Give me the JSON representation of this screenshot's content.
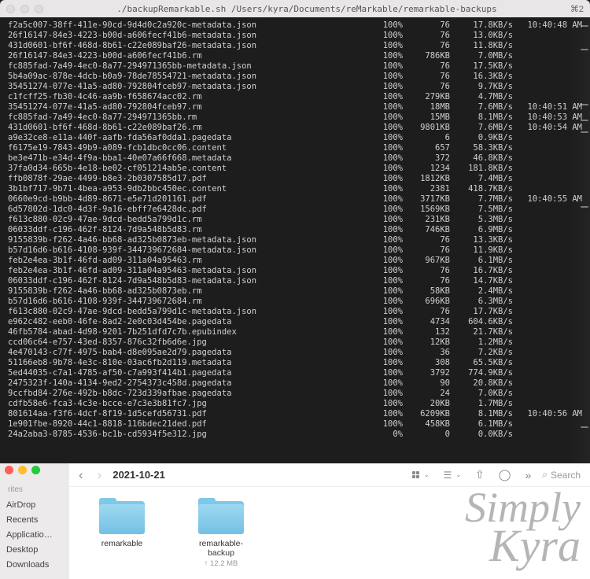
{
  "terminal": {
    "title": "./backupRemarkable.sh /Users/kyra/Documents/reMarkable/remarkable-backups",
    "shortcut": "⌘2",
    "rows": [
      {
        "f": "f2a5c007-38ff-411e-90cd-9d4d0c2a920c-metadata.json",
        "p": "100%",
        "s": "76",
        "r": "17.8KB/s",
        "t": "10:40:48 AM"
      },
      {
        "f": "26f16147-84e3-4223-b00d-a606fecf41b6-metadata.json",
        "p": "100%",
        "s": "76",
        "r": "13.0KB/s",
        "t": ""
      },
      {
        "f": "431d0601-bf6f-468d-8b61-c22e089baf26-metadata.json",
        "p": "100%",
        "s": "76",
        "r": "11.8KB/s",
        "t": ""
      },
      {
        "f": "26f16147-84e3-4223-b00d-a606fecf41b6.rm",
        "p": "100%",
        "s": "786KB",
        "r": "7.0MB/s",
        "t": ""
      },
      {
        "f": "fc885fad-7a49-4ec0-8a77-294971365bb-metadata.json",
        "p": "100%",
        "s": "76",
        "r": "17.5KB/s",
        "t": ""
      },
      {
        "f": "5b4a09ac-878e-4dcb-b0a9-78de78554721-metadata.json",
        "p": "100%",
        "s": "76",
        "r": "16.3KB/s",
        "t": ""
      },
      {
        "f": "35451274-077e-41a5-ad80-792804fceb97-metadata.json",
        "p": "100%",
        "s": "76",
        "r": "9.7KB/s",
        "t": ""
      },
      {
        "f": "c1fcff25-fb30-4c46-aa9b-f658674acc02.rm",
        "p": "100%",
        "s": "279KB",
        "r": "4.7MB/s",
        "t": ""
      },
      {
        "f": "35451274-077e-41a5-ad80-792804fceb97.rm",
        "p": "100%",
        "s": "18MB",
        "r": "7.6MB/s",
        "t": "10:40:51 AM"
      },
      {
        "f": "fc885fad-7a49-4ec0-8a77-294971365bb.rm",
        "p": "100%",
        "s": "15MB",
        "r": "8.1MB/s",
        "t": "10:40:53 AM"
      },
      {
        "f": "431d0601-bf6f-468d-8b61-c22e089baf26.rm",
        "p": "100%",
        "s": "9801KB",
        "r": "7.6MB/s",
        "t": "10:40:54 AM"
      },
      {
        "f": "a9e32ce8-e11a-440f-aafb-fda56af0dda1.pagedata",
        "p": "100%",
        "s": "6",
        "r": "0.9KB/s",
        "t": ""
      },
      {
        "f": "f6175e19-7843-49b9-a089-fcb1dbc0cc06.content",
        "p": "100%",
        "s": "657",
        "r": "58.3KB/s",
        "t": ""
      },
      {
        "f": "be3e471b-e34d-4f9a-bba1-40e07a66f668.metadata",
        "p": "100%",
        "s": "372",
        "r": "46.8KB/s",
        "t": ""
      },
      {
        "f": "37fa0d34-665b-4e18-be02-cf051214ab5e.content",
        "p": "100%",
        "s": "1234",
        "r": "181.8KB/s",
        "t": ""
      },
      {
        "f": "ffb0878f-29ae-4499-b8e3-2b0307585d17.pdf",
        "p": "100%",
        "s": "1812KB",
        "r": "7.4MB/s",
        "t": ""
      },
      {
        "f": "3b1bf717-9b71-4bea-a953-9db2bbc450ec.content",
        "p": "100%",
        "s": "2381",
        "r": "418.7KB/s",
        "t": ""
      },
      {
        "f": "0660e9cd-b9bb-4d89-8671-e5e71d201161.pdf",
        "p": "100%",
        "s": "3717KB",
        "r": "7.7MB/s",
        "t": "10:40:55 AM"
      },
      {
        "f": "6d57802d-1dc0-4d3f-9a16-ebff7e6428dc.pdf",
        "p": "100%",
        "s": "1569KB",
        "r": "7.5MB/s",
        "t": ""
      },
      {
        "f": "f613c880-02c9-47ae-9dcd-bedd5a799d1c.rm",
        "p": "100%",
        "s": "231KB",
        "r": "5.3MB/s",
        "t": ""
      },
      {
        "f": "06033ddf-c196-462f-8124-7d9a548b5d83.rm",
        "p": "100%",
        "s": "746KB",
        "r": "6.9MB/s",
        "t": ""
      },
      {
        "f": "9155839b-f262-4a46-bb68-ad325b0873eb-metadata.json",
        "p": "100%",
        "s": "76",
        "r": "13.3KB/s",
        "t": ""
      },
      {
        "f": "b57d16d6-b616-4108-939f-344739672684-metadata.json",
        "p": "100%",
        "s": "76",
        "r": "11.9KB/s",
        "t": ""
      },
      {
        "f": "feb2e4ea-3b1f-46fd-ad09-311a04a95463.rm",
        "p": "100%",
        "s": "967KB",
        "r": "6.1MB/s",
        "t": ""
      },
      {
        "f": "feb2e4ea-3b1f-46fd-ad09-311a04a95463-metadata.json",
        "p": "100%",
        "s": "76",
        "r": "16.7KB/s",
        "t": ""
      },
      {
        "f": "06033ddf-c196-462f-8124-7d9a548b5d83-metadata.json",
        "p": "100%",
        "s": "76",
        "r": "14.7KB/s",
        "t": ""
      },
      {
        "f": "9155839b-f262-4a46-bb68-ad325b0873eb.rm",
        "p": "100%",
        "s": "58KB",
        "r": "2.4MB/s",
        "t": ""
      },
      {
        "f": "b57d16d6-b616-4108-939f-344739672684.rm",
        "p": "100%",
        "s": "696KB",
        "r": "6.3MB/s",
        "t": ""
      },
      {
        "f": "f613c880-02c9-47ae-9dcd-bedd5a799d1c-metadata.json",
        "p": "100%",
        "s": "76",
        "r": "17.7KB/s",
        "t": ""
      },
      {
        "f": "e962c482-eeb0-46fe-8ad2-2e0c03d454be.pagedata",
        "p": "100%",
        "s": "4734",
        "r": "604.6KB/s",
        "t": ""
      },
      {
        "f": "46fb5784-abad-4d98-9201-7b251dfd7c7b.epubindex",
        "p": "100%",
        "s": "132",
        "r": "21.7KB/s",
        "t": ""
      },
      {
        "f": "ccd06c64-e757-43ed-8357-876c32fb6d6e.jpg",
        "p": "100%",
        "s": "12KB",
        "r": "1.2MB/s",
        "t": ""
      },
      {
        "f": "4e470143-c77f-4975-bab4-d8e095ae2d79.pagedata",
        "p": "100%",
        "s": "36",
        "r": "7.2KB/s",
        "t": ""
      },
      {
        "f": "51166eb8-9b78-4e3c-810e-03ac6fb2d119.metadata",
        "p": "100%",
        "s": "308",
        "r": "65.5KB/s",
        "t": ""
      },
      {
        "f": "5ed44035-c7a1-4785-af50-c7a993f414b1.pagedata",
        "p": "100%",
        "s": "3792",
        "r": "774.9KB/s",
        "t": ""
      },
      {
        "f": "2475323f-140a-4134-9ed2-2754373c458d.pagedata",
        "p": "100%",
        "s": "90",
        "r": "20.8KB/s",
        "t": ""
      },
      {
        "f": "9ccfbd84-276e-492b-b8dc-723d339afbae.pagedata",
        "p": "100%",
        "s": "24",
        "r": "7.0KB/s",
        "t": ""
      },
      {
        "f": "cdfb58e6-fca3-4c3e-bcce-e7c3e3b81fc7.jpg",
        "p": "100%",
        "s": "20KB",
        "r": "1.7MB/s",
        "t": ""
      },
      {
        "f": "801614aa-f3f6-4dcf-8f19-1d5cefd56731.pdf",
        "p": "100%",
        "s": "6209KB",
        "r": "8.1MB/s",
        "t": "10:40:56 AM"
      },
      {
        "f": "1e901fbe-8920-44c1-8818-116bdec21ded.pdf",
        "p": "100%",
        "s": "458KB",
        "r": "6.1MB/s",
        "t": ""
      },
      {
        "f": "24a2aba3-8785-4536-bc1b-cd5934f5e312.jpg",
        "p": "0%",
        "s": "0",
        "r": "0.0KB/s",
        "t": ""
      }
    ]
  },
  "finder": {
    "breadcrumb": "2021-10-21",
    "search_placeholder": "Search",
    "sidebar": {
      "group": "rites",
      "items": [
        "AirDrop",
        "Recents",
        "Applicatio…",
        "Desktop",
        "Downloads"
      ]
    },
    "folders": [
      {
        "name": "remarkable",
        "sub": ""
      },
      {
        "name": "remarkable-backup",
        "sub": "↑ 12.2 MB"
      }
    ]
  },
  "watermark": {
    "line1": "Simply",
    "line2": "Kyra"
  }
}
